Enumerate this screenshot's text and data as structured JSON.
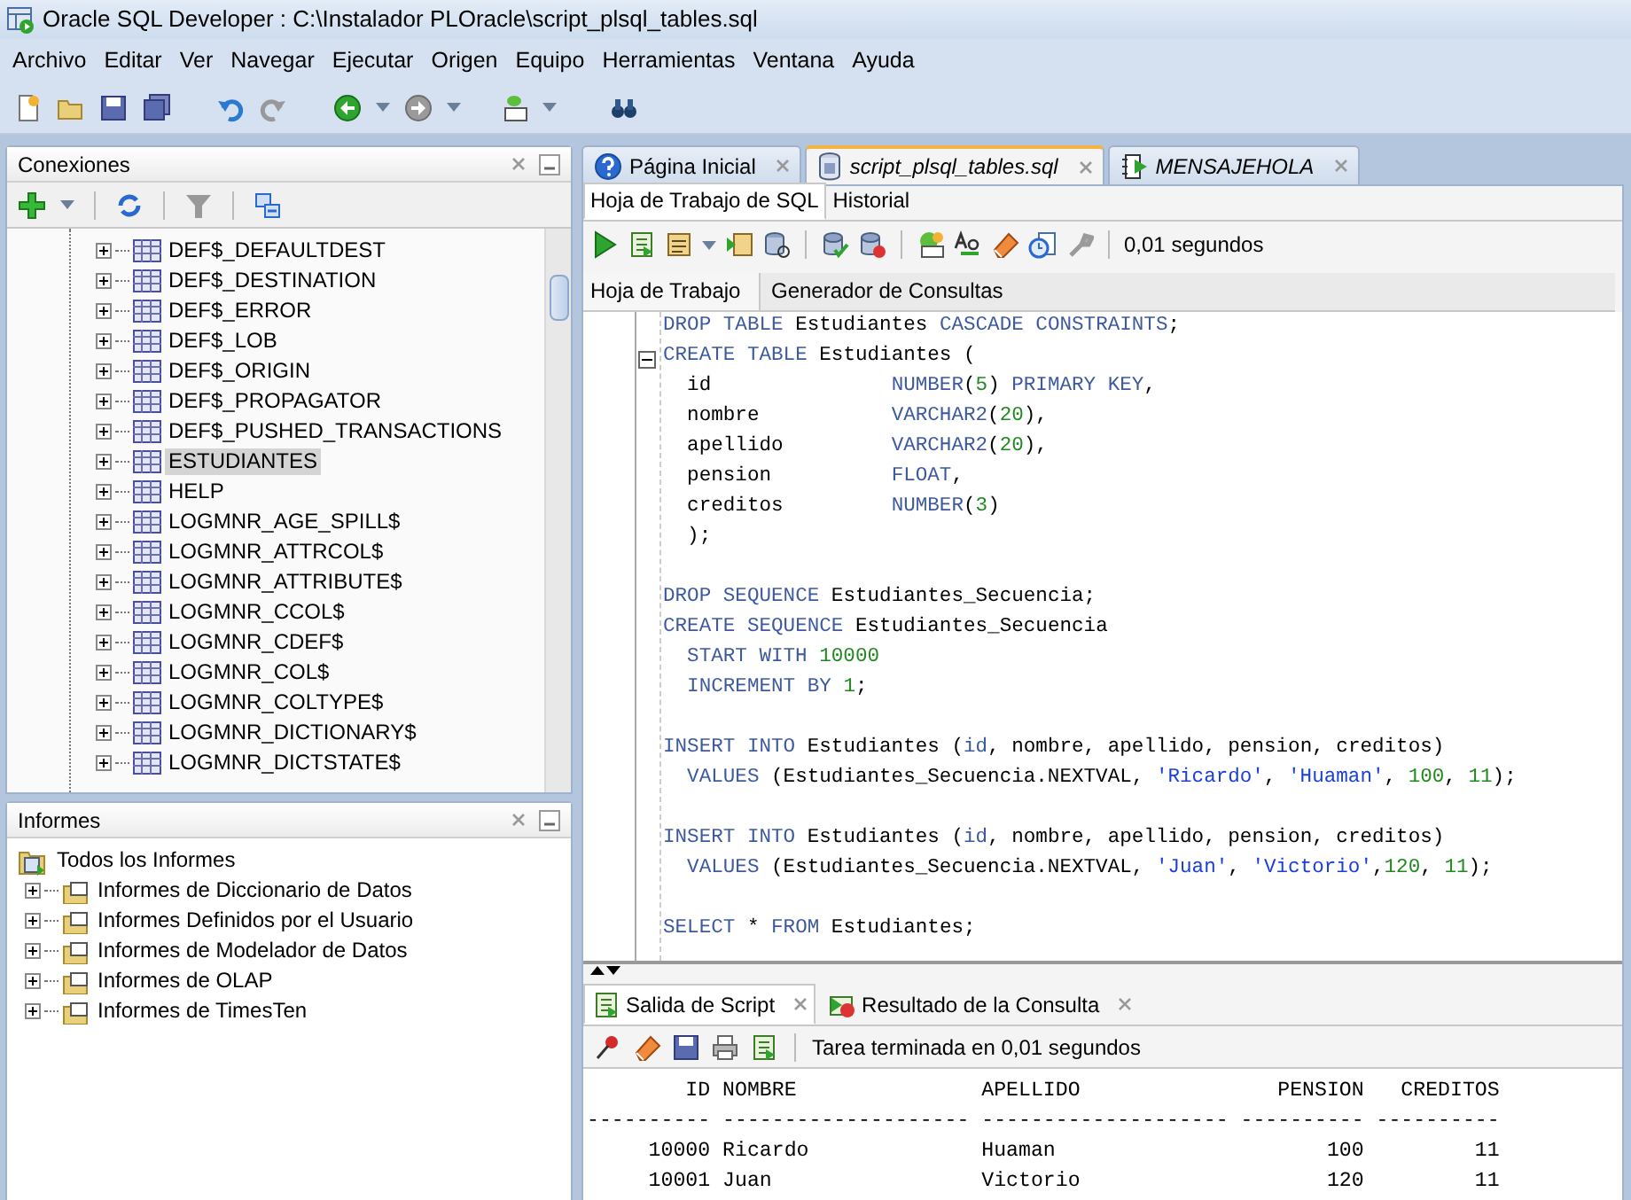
{
  "window": {
    "title": "Oracle SQL Developer : C:\\Instalador PLOracle\\script_plsql_tables.sql"
  },
  "menu": [
    "Archivo",
    "Editar",
    "Ver",
    "Navegar",
    "Ejecutar",
    "Origen",
    "Equipo",
    "Herramientas",
    "Ventana",
    "Ayuda"
  ],
  "connections_panel": {
    "title": "Conexiones",
    "items": [
      {
        "label": "DEF$_DEFAULTDEST",
        "expanded": false,
        "selected": false
      },
      {
        "label": "DEF$_DESTINATION",
        "expanded": false,
        "selected": false
      },
      {
        "label": "DEF$_ERROR",
        "expanded": false,
        "selected": false
      },
      {
        "label": "DEF$_LOB",
        "expanded": false,
        "selected": false
      },
      {
        "label": "DEF$_ORIGIN",
        "expanded": false,
        "selected": false
      },
      {
        "label": "DEF$_PROPAGATOR",
        "expanded": false,
        "selected": false
      },
      {
        "label": "DEF$_PUSHED_TRANSACTIONS",
        "expanded": false,
        "selected": false
      },
      {
        "label": "ESTUDIANTES",
        "expanded": false,
        "selected": true
      },
      {
        "label": "HELP",
        "expanded": false,
        "selected": false
      },
      {
        "label": "LOGMNR_AGE_SPILL$",
        "expanded": false,
        "selected": false
      },
      {
        "label": "LOGMNR_ATTRCOL$",
        "expanded": false,
        "selected": false
      },
      {
        "label": "LOGMNR_ATTRIBUTE$",
        "expanded": false,
        "selected": false
      },
      {
        "label": "LOGMNR_CCOL$",
        "expanded": false,
        "selected": false
      },
      {
        "label": "LOGMNR_CDEF$",
        "expanded": false,
        "selected": false
      },
      {
        "label": "LOGMNR_COL$",
        "expanded": false,
        "selected": false
      },
      {
        "label": "LOGMNR_COLTYPE$",
        "expanded": false,
        "selected": false
      },
      {
        "label": "LOGMNR_DICTIONARY$",
        "expanded": false,
        "selected": false
      },
      {
        "label": "LOGMNR_DICTSTATE$",
        "expanded": false,
        "selected": false
      }
    ]
  },
  "reports_panel": {
    "title": "Informes",
    "tree": [
      {
        "label": "Todos los Informes",
        "children": [
          {
            "label": "Informes de Diccionario de Datos",
            "expanded": false
          },
          {
            "label": "Informes Definidos por el Usuario",
            "expanded": false
          },
          {
            "label": "Informes de Modelador de Datos",
            "expanded": false
          },
          {
            "label": "Informes de OLAP",
            "expanded": false
          },
          {
            "label": "Informes de TimesTen",
            "expanded": false
          }
        ]
      }
    ]
  },
  "editor_tabs": [
    {
      "label": "Página Inicial",
      "kind": "start",
      "selected": false
    },
    {
      "label": "script_plsql_tables.sql",
      "kind": "sql",
      "selected": true
    },
    {
      "label": "MENSAJEHOLA",
      "kind": "procedure",
      "selected": false
    }
  ],
  "sub_tabs": [
    {
      "label": "Hoja de Trabajo de SQL",
      "selected": true
    },
    {
      "label": "Historial",
      "selected": false
    }
  ],
  "toolbar_status": "0,01 segundos",
  "worksheet_tabs": [
    {
      "label": "Hoja de Trabajo",
      "selected": true
    },
    {
      "label": "Generador de Consultas",
      "selected": false
    }
  ],
  "code": [
    {
      "lines": [
        {
          "tokens": [
            {
              "kind": "keyword",
              "text": "DROP TABLE"
            },
            {
              "kind": "plain",
              "text": " Estudiantes "
            },
            {
              "kind": "keyword",
              "text": "CASCADE CONSTRAINTS"
            },
            {
              "kind": "plain",
              "text": ";"
            }
          ]
        },
        {
          "fold": true,
          "tokens": [
            {
              "kind": "keyword",
              "text": "CREATE TABLE"
            },
            {
              "kind": "plain",
              "text": " Estudiantes ("
            }
          ]
        },
        {
          "tokens": [
            {
              "kind": "plain",
              "text": "  id               "
            },
            {
              "kind": "keyword",
              "text": "NUMBER"
            },
            {
              "kind": "plain",
              "text": "("
            },
            {
              "kind": "number",
              "text": "5"
            },
            {
              "kind": "plain",
              "text": ") "
            },
            {
              "kind": "keyword",
              "text": "PRIMARY KEY"
            },
            {
              "kind": "plain",
              "text": ","
            }
          ]
        },
        {
          "tokens": [
            {
              "kind": "plain",
              "text": "  nombre           "
            },
            {
              "kind": "keyword",
              "text": "VARCHAR2"
            },
            {
              "kind": "plain",
              "text": "("
            },
            {
              "kind": "number",
              "text": "20"
            },
            {
              "kind": "plain",
              "text": "),"
            }
          ]
        },
        {
          "tokens": [
            {
              "kind": "plain",
              "text": "  apellido         "
            },
            {
              "kind": "keyword",
              "text": "VARCHAR2"
            },
            {
              "kind": "plain",
              "text": "("
            },
            {
              "kind": "number",
              "text": "20"
            },
            {
              "kind": "plain",
              "text": "),"
            }
          ]
        },
        {
          "tokens": [
            {
              "kind": "plain",
              "text": "  pension          "
            },
            {
              "kind": "keyword",
              "text": "FLOAT"
            },
            {
              "kind": "plain",
              "text": ","
            }
          ]
        },
        {
          "tokens": [
            {
              "kind": "plain",
              "text": "  creditos         "
            },
            {
              "kind": "keyword",
              "text": "NUMBER"
            },
            {
              "kind": "plain",
              "text": "("
            },
            {
              "kind": "number",
              "text": "3"
            },
            {
              "kind": "plain",
              "text": ")"
            }
          ]
        },
        {
          "tokens": [
            {
              "kind": "plain",
              "text": "  );"
            }
          ]
        }
      ]
    },
    {
      "lines": [
        {
          "tokens": [
            {
              "kind": "keyword",
              "text": "DROP SEQUENCE"
            },
            {
              "kind": "plain",
              "text": " Estudiantes_Secuencia;"
            }
          ]
        },
        {
          "tokens": [
            {
              "kind": "keyword",
              "text": "CREATE SEQUENCE"
            },
            {
              "kind": "plain",
              "text": " Estudiantes_Secuencia"
            }
          ]
        },
        {
          "indent": true,
          "tokens": [
            {
              "kind": "keyword",
              "text": "START WITH "
            },
            {
              "kind": "number",
              "text": "10000"
            }
          ]
        },
        {
          "indent": true,
          "tokens": [
            {
              "kind": "keyword",
              "text": "INCREMENT BY "
            },
            {
              "kind": "number",
              "text": "1"
            },
            {
              "kind": "plain",
              "text": ";"
            }
          ]
        }
      ]
    },
    {
      "lines": [
        {
          "tokens": [
            {
              "kind": "keyword",
              "text": "INSERT INTO"
            },
            {
              "kind": "plain",
              "text": " Estudiantes ("
            },
            {
              "kind": "keyword",
              "text": "id"
            },
            {
              "kind": "plain",
              "text": ", nombre, apellido, pension, creditos)"
            }
          ]
        },
        {
          "indent": true,
          "tokens": [
            {
              "kind": "keyword",
              "text": "VALUES"
            },
            {
              "kind": "plain",
              "text": " (Estudiantes_Secuencia.NEXTVAL, "
            },
            {
              "kind": "string",
              "text": "'Ricardo'"
            },
            {
              "kind": "plain",
              "text": ", "
            },
            {
              "kind": "string",
              "text": "'Huaman'"
            },
            {
              "kind": "plain",
              "text": ", "
            },
            {
              "kind": "number",
              "text": "100"
            },
            {
              "kind": "plain",
              "text": ", "
            },
            {
              "kind": "number",
              "text": "11"
            },
            {
              "kind": "plain",
              "text": ");"
            }
          ]
        }
      ]
    },
    {
      "lines": [
        {
          "tokens": [
            {
              "kind": "keyword",
              "text": "INSERT INTO"
            },
            {
              "kind": "plain",
              "text": " Estudiantes ("
            },
            {
              "kind": "keyword",
              "text": "id"
            },
            {
              "kind": "plain",
              "text": ", nombre, apellido, pension, creditos)"
            }
          ]
        },
        {
          "indent": true,
          "tokens": [
            {
              "kind": "keyword",
              "text": "VALUES"
            },
            {
              "kind": "plain",
              "text": " (Estudiantes_Secuencia.NEXTVAL, "
            },
            {
              "kind": "string",
              "text": "'Juan'"
            },
            {
              "kind": "plain",
              "text": ", "
            },
            {
              "kind": "string",
              "text": "'Victorio'"
            },
            {
              "kind": "plain",
              "text": ","
            },
            {
              "kind": "number",
              "text": "120"
            },
            {
              "kind": "plain",
              "text": ", "
            },
            {
              "kind": "number",
              "text": "11"
            },
            {
              "kind": "plain",
              "text": ");"
            }
          ]
        }
      ]
    },
    {
      "lines": [
        {
          "tokens": [
            {
              "kind": "keyword",
              "text": "SELECT"
            },
            {
              "kind": "plain",
              "text": " * "
            },
            {
              "kind": "keyword",
              "text": "FROM"
            },
            {
              "kind": "plain",
              "text": " Estudiantes;"
            }
          ]
        }
      ]
    }
  ],
  "output_tabs": [
    {
      "label": "Salida de Script",
      "selected": true
    },
    {
      "label": "Resultado de la Consulta",
      "selected": false
    }
  ],
  "output_status": "Tarea terminada en 0,01 segundos",
  "output_lines": [
    "        ID NOMBRE               APELLIDO                PENSION   CREDITOS",
    "---------- -------------------- -------------------- ---------- ----------",
    "     10000 Ricardo              Huaman                      100         11",
    "     10001 Juan                 Victorio                    120         11"
  ]
}
